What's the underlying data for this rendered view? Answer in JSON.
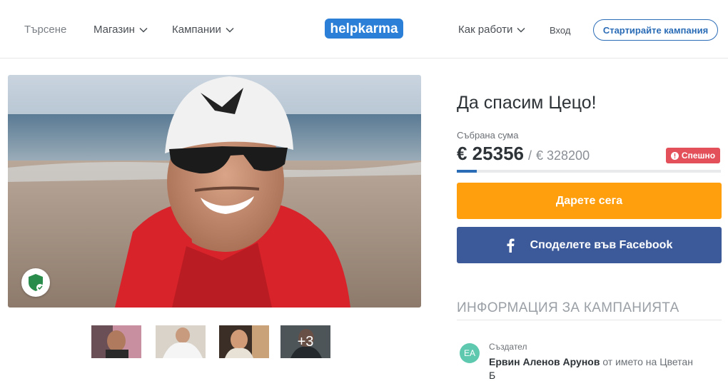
{
  "header": {
    "search_label": "Търсене",
    "shop_label": "Магазин",
    "campaigns_label": "Кампании",
    "logo_text": "helpkarma",
    "how_label": "Как работи",
    "login_label": "Вход",
    "start_campaign_label": "Стартирайте кампания"
  },
  "campaign": {
    "title": "Да спасим Цецо!",
    "raised_label": "Събрана сума",
    "raised_amount": "€ 25356",
    "goal_separator": "/",
    "goal_amount": "€ 328200",
    "urgent_badge": "Спешно",
    "progress_fraction": 0.077,
    "donate_label": "Дарете сега",
    "share_facebook_label": "Споделете във Facebook",
    "thumbnails_more": "+3"
  },
  "info": {
    "heading": "ИНФОРМАЦИЯ ЗА КАМПАНИЯТА",
    "avatar_initials": "ЕА",
    "creator_label": "Създател",
    "creator_name": "Ервин Аленов Арунов",
    "on_behalf": "от името на Цветан",
    "on_behalf_cont": "Б"
  },
  "colors": {
    "primary": "#2b6cb7",
    "donate": "#ff9f0d",
    "facebook": "#3c5a99",
    "urgent": "#e3505a",
    "avatar": "#5fc9b0"
  },
  "icons": [
    "chevron-down-icon",
    "shield-check-icon",
    "alert-icon",
    "facebook-icon"
  ]
}
